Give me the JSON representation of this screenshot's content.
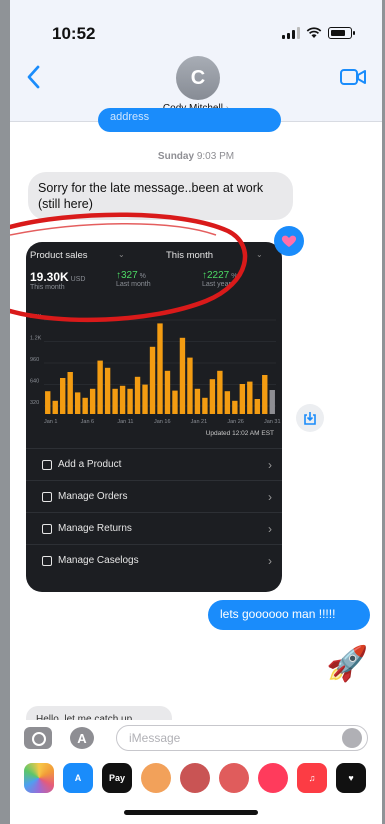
{
  "status": {
    "time": "10:52"
  },
  "header": {
    "avatar_initial": "C",
    "contact_name": "Cody Mitchell",
    "contact_chevron": "›"
  },
  "thread": {
    "prev_bubble_text": "address",
    "timestamp_day": "Sunday",
    "timestamp_time": "9:03 PM",
    "incoming_message": "Sorry for the late message..been at work (still here)",
    "outgoing_message": "lets goooooo man !!!!!",
    "rocket_emoji": "🚀",
    "partial_incoming": "Hello, let me catch up"
  },
  "attachment": {
    "header_left": "Product sales",
    "header_right": "This month",
    "kpis": [
      {
        "value": "19.30K",
        "unit": "USD",
        "caption": "This month"
      },
      {
        "value": "↑327",
        "unit": "%",
        "caption": "Last month"
      },
      {
        "value": "↑2227",
        "unit": "%",
        "caption": "Last year"
      }
    ],
    "updated": "Updated 12:02 AM EST",
    "menu": [
      {
        "label": "Add a Product",
        "icon": "tag-icon"
      },
      {
        "label": "Manage Orders",
        "icon": "box-icon"
      },
      {
        "label": "Manage Returns",
        "icon": "return-icon"
      },
      {
        "label": "Manage Caselogs",
        "icon": "chat-icon"
      }
    ],
    "menu_chevron": "›"
  },
  "chart_data": {
    "type": "bar",
    "title": "Product sales",
    "y_ticks": [
      "1.6K",
      "1.2K",
      "960",
      "640",
      "320"
    ],
    "x_ticks": [
      "Jan 1",
      "Jan 6",
      "Jan 11",
      "Jan 16",
      "Jan 21",
      "Jan 26",
      "Jan 31"
    ],
    "values": [
      380,
      220,
      600,
      700,
      360,
      270,
      420,
      890,
      770,
      420,
      470,
      420,
      620,
      490,
      1120,
      1510,
      720,
      390,
      1270,
      940,
      420,
      270,
      580,
      720,
      380,
      220,
      500,
      540,
      250,
      650,
      400
    ],
    "ylim": [
      0,
      1700
    ],
    "bar_color": "#f39c12",
    "last_bar_color": "#8e8e93"
  },
  "compose": {
    "placeholder": "iMessage",
    "apps_label": "A"
  },
  "apps": [
    {
      "name": "photos-app-icon",
      "label": "",
      "color": "#ffffff"
    },
    {
      "name": "appstore-app-icon",
      "label": "A",
      "color": "#1a8cfb"
    },
    {
      "name": "applepay-app-icon",
      "label": "Pay",
      "color": "#111111"
    },
    {
      "name": "memoji-app-icon",
      "label": "",
      "color": "#f2a15a"
    },
    {
      "name": "memoji2-app-icon",
      "label": "",
      "color": "#c95454"
    },
    {
      "name": "memoji3-app-icon",
      "label": "",
      "color": "#e05c5c"
    },
    {
      "name": "search-app-icon",
      "label": "",
      "color": "#ff3b5c"
    },
    {
      "name": "music-app-icon",
      "label": "♫",
      "color": "#fc3c44"
    },
    {
      "name": "heart-app-icon",
      "label": "♥",
      "color": "#111111"
    }
  ]
}
